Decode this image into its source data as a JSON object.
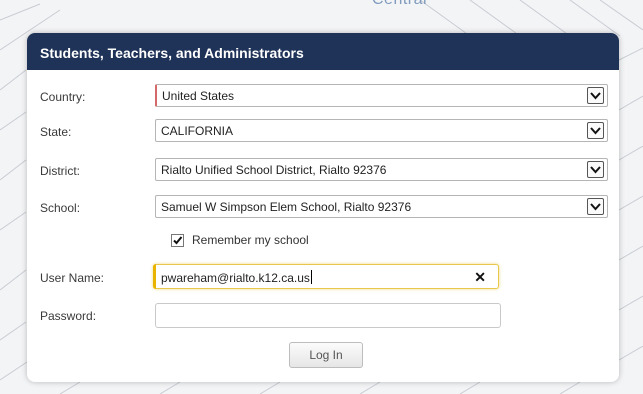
{
  "header_fragment": "Central",
  "panel": {
    "title": "Students, Teachers, and Administrators"
  },
  "form": {
    "country": {
      "label": "Country:",
      "value": "United States"
    },
    "state": {
      "label": "State:",
      "value": "CALIFORNIA"
    },
    "district": {
      "label": "District:",
      "value": "Rialto Unified School District, Rialto 92376"
    },
    "school": {
      "label": "School:",
      "value": "Samuel W Simpson Elem School, Rialto 92376"
    },
    "remember": {
      "label": "Remember my school",
      "checked": true
    },
    "username": {
      "label": "User Name:",
      "value": "pwareham@rialto.k12.ca.us",
      "clear_symbol": "✕"
    },
    "password": {
      "label": "Password:",
      "value": ""
    },
    "login_label": "Log In"
  },
  "colors": {
    "header_bg": "#1f3358",
    "focus_accent": "#e9b400",
    "required_edge": "#d36a6a"
  },
  "icons": [
    "dropdown-arrow-icon",
    "checkmark-icon",
    "clear-icon"
  ]
}
